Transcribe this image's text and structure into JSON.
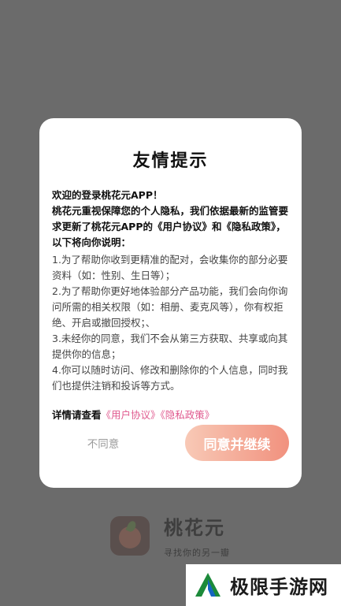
{
  "background": {
    "app_name": "桃花元",
    "app_slogan": "寻找你的另一瓣"
  },
  "dialog": {
    "title": "友情提示",
    "intro_lines": [
      "欢迎的登录桃花元APP！",
      "桃花元重视保障您的个人隐私，我们依据最新的监管要求更新了桃花元APP的《用户协议》和《隐私政策》，以下将向你说明："
    ],
    "terms": [
      "1.为了帮助你收到更精准的配对，会收集你的部分必要资料（如：性别、生日等）；",
      "2.为了帮助你更好地体验部分产品功能，我们会向你询问所需的相关权限（如：相册、麦克风等），你有权拒绝、开启或撤回授权；、",
      "3.未经你的同意，我们不会从第三方获取、共享或向其提供你的信息；",
      "4.你可以随时访问、修改和删除你的个人信息，同时我们也提供注销和投诉等方式。"
    ],
    "details_label": "详情请查看",
    "user_agreement_link": "《用户协议》",
    "privacy_policy_link": "《隐私政策》",
    "disagree_label": "不同意",
    "agree_label": "同意并继续"
  },
  "watermark": {
    "text": "极限手游网"
  },
  "colors": {
    "overlay": "#6b6b6b",
    "link": "#e05a8f",
    "agree_gradient_start": "#f8c9b6",
    "agree_gradient_end": "#f1917e"
  }
}
